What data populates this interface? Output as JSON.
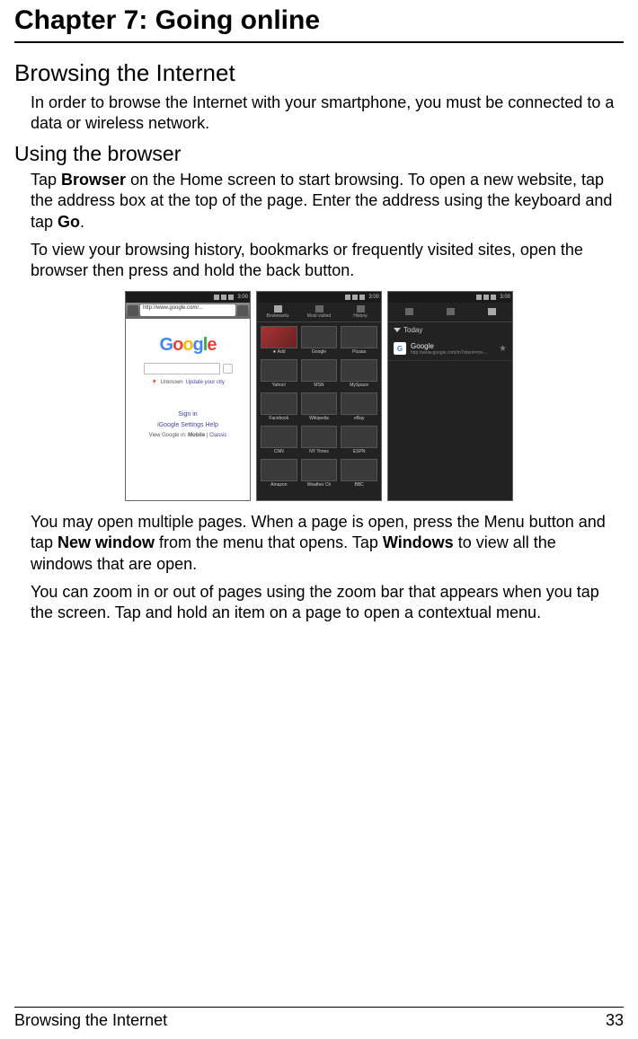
{
  "chapter_title": "Chapter 7: Going online",
  "section_title": "Browsing the Internet",
  "intro_para": "In order to browse the Internet with your smartphone, you must be connected to a data or wireless network.",
  "subsection_title": "Using the browser",
  "para1_a": "Tap ",
  "para1_bold1": "Browser",
  "para1_b": " on the Home screen to start browsing. To open a new website, tap the address box at the top of the page. Enter the address using the keyboard and tap ",
  "para1_bold2": "Go",
  "para1_c": ".",
  "para2": "To view your browsing history, bookmarks or frequently visited sites, open the browser then press and hold the back button.",
  "para3_a": "You may open multiple pages. When a page is open, press the Menu button and tap ",
  "para3_bold1": "New window",
  "para3_b": " from the menu that opens. Tap ",
  "para3_bold2": "Windows",
  "para3_c": " to view all the windows that are open.",
  "para4": "You can zoom in or out of pages using the zoom bar that appears when you tap the screen. Tap and hold an item on a page to open a contextual menu.",
  "footer_left": "Browsing the Internet",
  "footer_right": "33",
  "screens": {
    "status_time": "3:00",
    "s1": {
      "url": "http://www.google.com/...",
      "logo": "Google",
      "location": "Unknown",
      "location_action": "Update your city",
      "link_signin": "Sign in",
      "links": "iGoogle   Settings   Help",
      "view_line_a": "View Google in: ",
      "view_line_bold": "Mobile",
      "view_line_b": " | ",
      "view_line_link": "Classic"
    },
    "s2": {
      "tab1": "Bookmarks",
      "tab2": "Most visited",
      "tab3": "History",
      "cells": [
        "★ Add",
        "Google",
        "Picasa",
        "Yahoo!",
        "MSN",
        "MySpace",
        "Facebook",
        "Wikipedia",
        "eBay",
        "CNN",
        "NY Times",
        "ESPN",
        "Amazon",
        "Weather Ch",
        "BBC"
      ]
    },
    "s3": {
      "header": "Today",
      "item_title": "Google",
      "item_sub": "http://www.google.com/m?client=ms-..."
    }
  }
}
